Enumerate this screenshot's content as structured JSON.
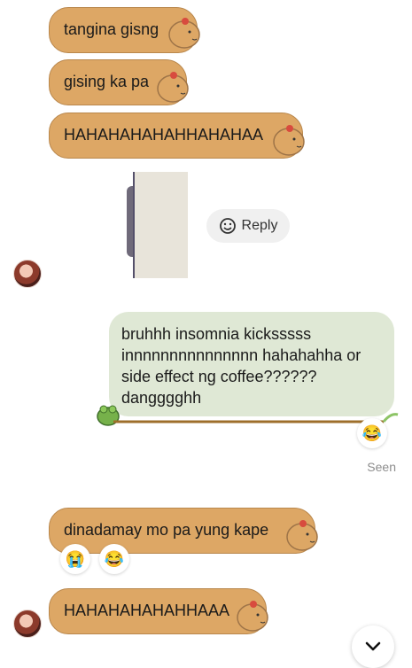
{
  "messages": {
    "m1": "tangina gisng",
    "m2": "gising ka pa",
    "m3": "HAHAHAHAHAHHAHAHAA",
    "reply_label": "Reply",
    "m4": "bruhhh insomnia kicksssss innnnnnnnnnnnnnn hahahahha or side effect ng coffee?????? dangggghh",
    "m5": "dinadamay mo pa yung kape",
    "m6": "HAHAHAHAHAHHAAA",
    "seen": "Seen"
  },
  "reactions": {
    "r1": "😂",
    "r2": "😭",
    "r3": "😂"
  },
  "icons": {
    "reply": "smiley-icon",
    "scroll": "chevron-down-icon"
  },
  "colors": {
    "incoming": "#dda765",
    "outgoing": "#dfe8d5",
    "seen": "#8d8d8d"
  }
}
